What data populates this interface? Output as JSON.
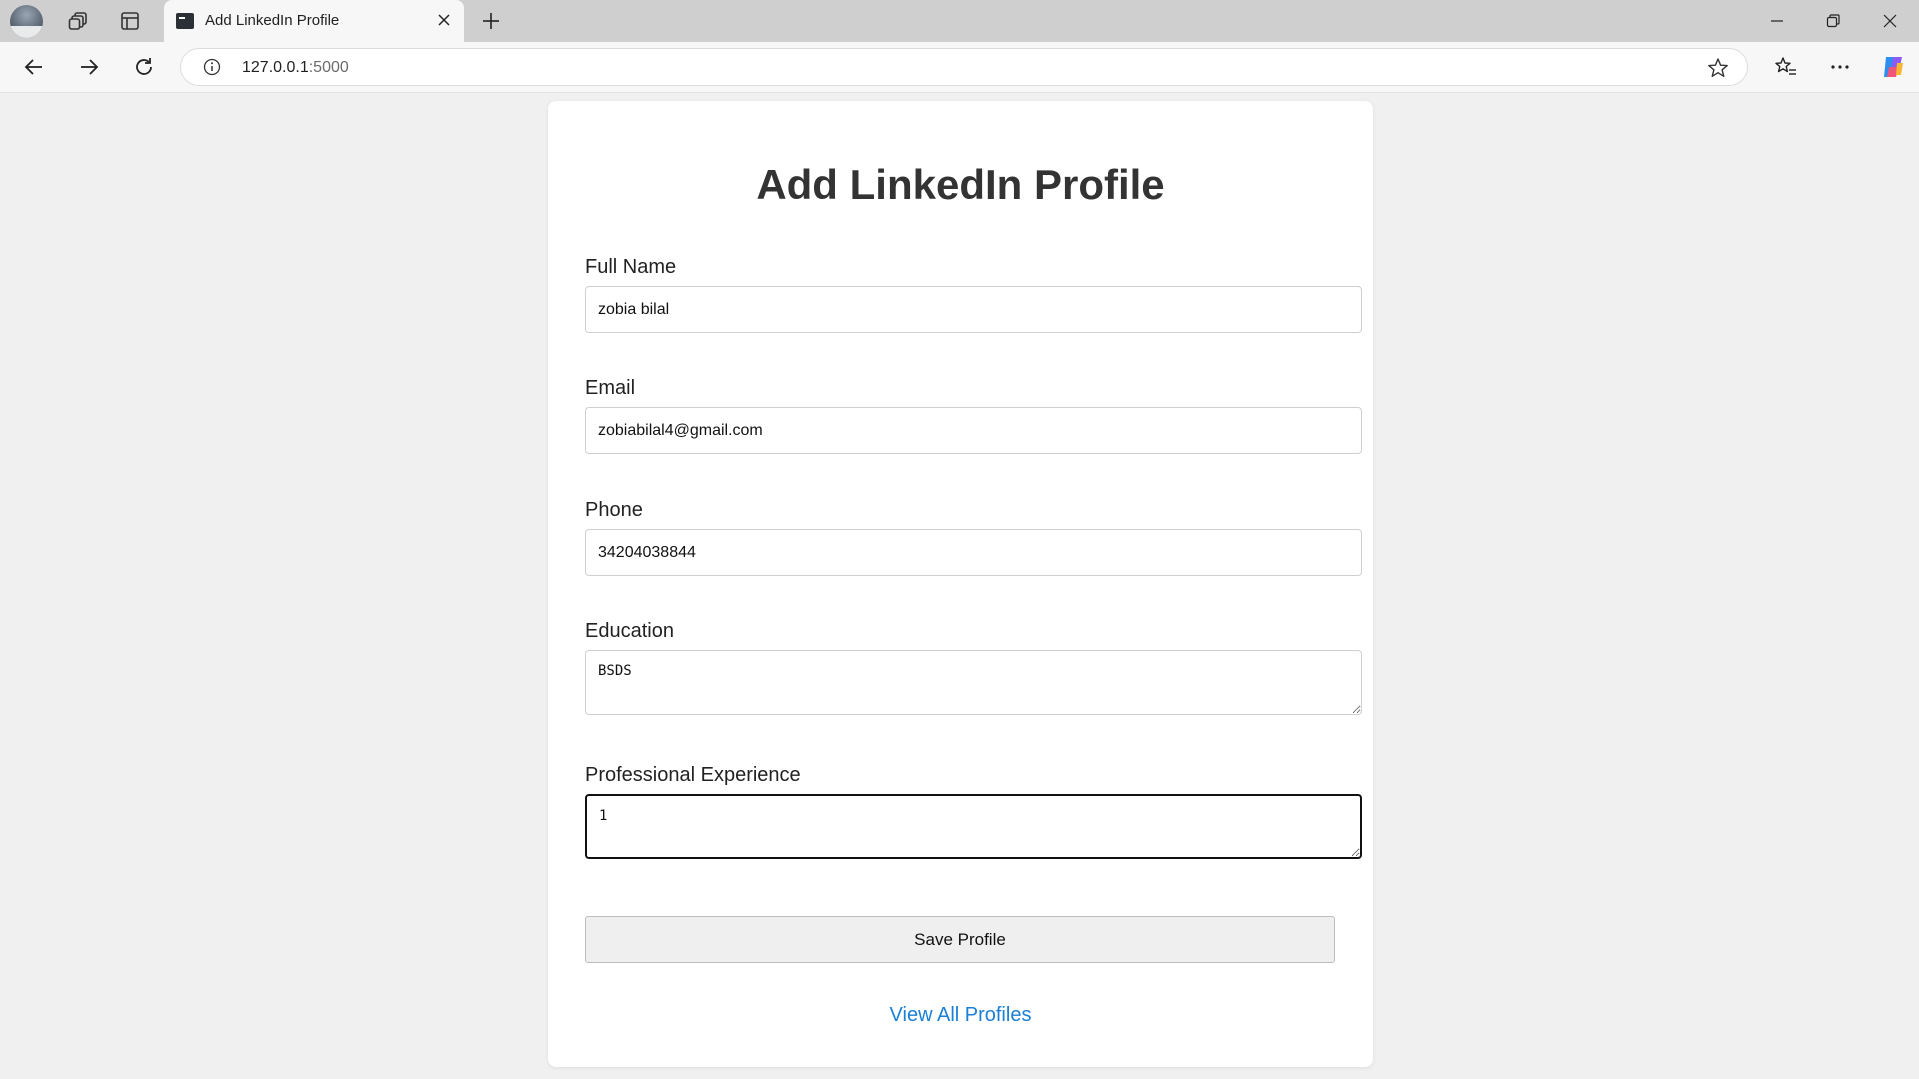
{
  "browser": {
    "tab_title": "Add LinkedIn Profile",
    "url_host": "127.0.0.1",
    "url_port": ":5000",
    "icons": {
      "profile": "profile-avatar",
      "workspaces": "workspaces-icon",
      "vertical_tabs": "vertical-tabs-icon",
      "tab_favicon": "terminal-favicon-icon",
      "tab_close": "close-icon",
      "new_tab": "plus-icon",
      "back": "back-arrow-icon",
      "forward": "forward-arrow-icon",
      "refresh": "refresh-icon",
      "site_info": "info-icon",
      "favorite": "star-icon",
      "favorites": "favorites-list-icon",
      "menu": "more-icon",
      "copilot": "copilot-icon",
      "minimize": "minimize-icon",
      "restore": "restore-icon",
      "close_window": "close-window-icon"
    }
  },
  "page": {
    "title": "Add LinkedIn Profile",
    "fields": [
      {
        "label": "Full Name",
        "value": "zobia bilal"
      },
      {
        "label": "Email",
        "value": "zobiabilal4@gmail.com"
      },
      {
        "label": "Phone",
        "value": "34204038844"
      },
      {
        "label": "Education",
        "value": "BSDS"
      },
      {
        "label": "Professional Experience",
        "value": "1"
      }
    ],
    "save_button": "Save Profile",
    "view_link": "View All Profiles",
    "colors": {
      "link": "#1a7fd6",
      "background": "#f0f0f0",
      "card": "#ffffff"
    }
  }
}
